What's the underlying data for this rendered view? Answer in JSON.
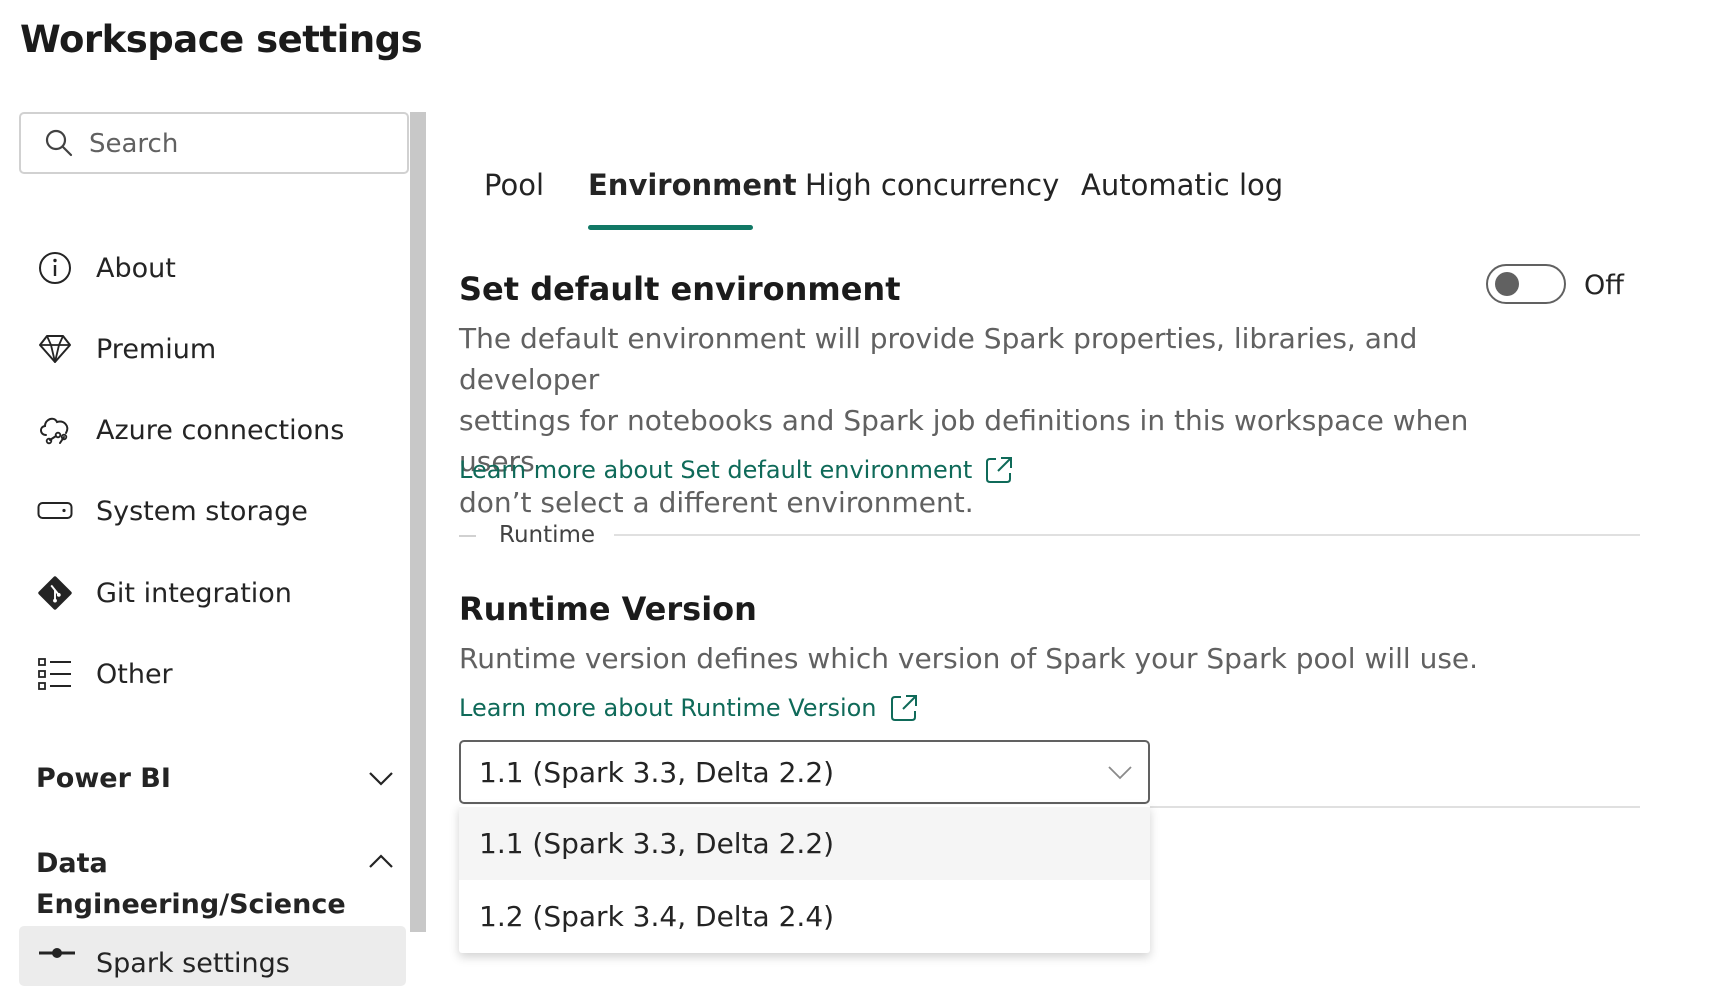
{
  "page_title": "Workspace settings",
  "search": {
    "placeholder": "Search"
  },
  "sidebar": {
    "items": [
      {
        "label": "About",
        "icon": "info-icon"
      },
      {
        "label": "Premium",
        "icon": "diamond-icon"
      },
      {
        "label": "Azure connections",
        "icon": "cloud-link-icon"
      },
      {
        "label": "System storage",
        "icon": "storage-icon"
      },
      {
        "label": "Git integration",
        "icon": "git-icon"
      },
      {
        "label": "Other",
        "icon": "list-icon"
      }
    ],
    "sections": [
      {
        "label": "Power BI",
        "state": "collapsed"
      },
      {
        "label": "Data Engineering/Science",
        "state": "expanded"
      }
    ],
    "sub_item": {
      "label": "Spark settings",
      "icon": "slider-icon"
    }
  },
  "tabs": [
    {
      "label": "Pool"
    },
    {
      "label": "Environment",
      "active": true
    },
    {
      "label": "High concurrency"
    },
    {
      "label": "Automatic log"
    }
  ],
  "default_env": {
    "title": "Set default environment",
    "toggle_state": "Off",
    "description_lines": [
      "The default environment will provide Spark properties, libraries, and developer",
      "settings for notebooks and Spark job definitions in this workspace when users",
      "don’t select a different environment."
    ],
    "link": "Learn more about Set default environment"
  },
  "divider_label": "Runtime",
  "runtime": {
    "title": "Runtime Version",
    "description": "Runtime version defines which version of Spark your Spark pool will use.",
    "link": "Learn more about Runtime Version",
    "selected": "1.1 (Spark 3.3, Delta 2.2)",
    "options": [
      "1.1 (Spark 3.3, Delta 2.2)",
      "1.2 (Spark 3.4, Delta 2.4)"
    ]
  },
  "colors": {
    "accent": "#117865",
    "link": "#0f6a59",
    "text": "#242424"
  }
}
